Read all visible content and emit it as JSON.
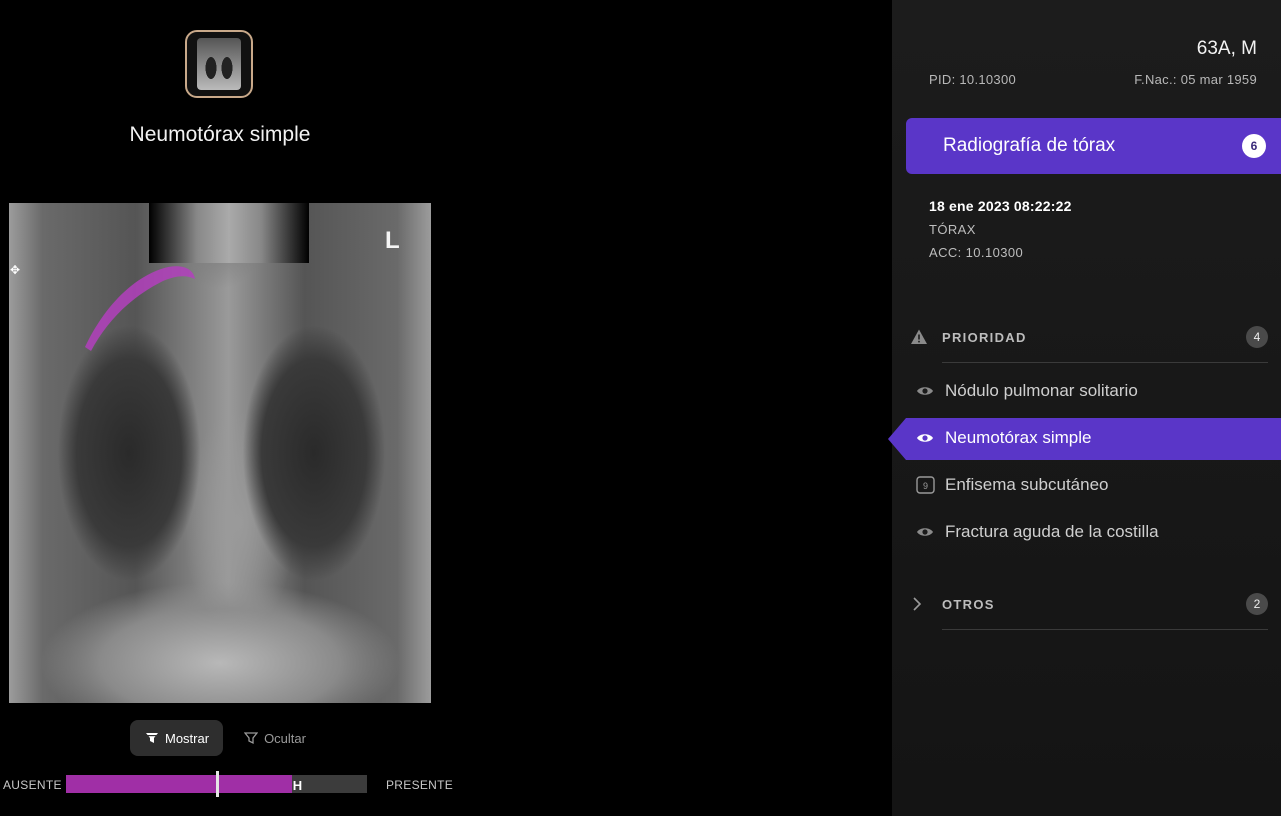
{
  "viewer": {
    "finding_title": "Neumotórax simple",
    "image_marker": "L",
    "toggle": {
      "show_label": "Mostrar",
      "hide_label": "Ocultar",
      "active": "show"
    },
    "slider": {
      "left_label": "AUSENTE",
      "right_label": "PRESENTE",
      "fill_fraction": 0.75,
      "thumb_fraction": 0.5,
      "handle_fraction": 0.77,
      "handle_glyph": "H"
    },
    "colors": {
      "overlay": "#b33fbd",
      "accent": "#5a36c8"
    }
  },
  "patient": {
    "age_sex": "63A, M",
    "pid": "PID: 10.10300",
    "dob": "F.Nac.: 05 mar 1959"
  },
  "study": {
    "title": "Radiografía de tórax",
    "count": "6",
    "date": "18 ene 2023 08:22:22",
    "region": "TÓRAX",
    "acc": "ACC: 10.10300"
  },
  "sections": {
    "priority": {
      "label": "PRIORIDAD",
      "count": "4",
      "icon": "warning-icon",
      "items": [
        {
          "label": "Nódulo pulmonar solitario",
          "icon": "eye-icon",
          "selected": false
        },
        {
          "label": "Neumotórax simple",
          "icon": "eye-icon",
          "selected": true
        },
        {
          "label": "Enfisema subcutáneo",
          "icon": "count-box-icon",
          "badge": "9",
          "selected": false
        },
        {
          "label": "Fractura aguda de la costilla",
          "icon": "eye-icon",
          "selected": false
        }
      ]
    },
    "others": {
      "label": "OTROS",
      "count": "2",
      "icon": "chevron-right-icon"
    }
  }
}
